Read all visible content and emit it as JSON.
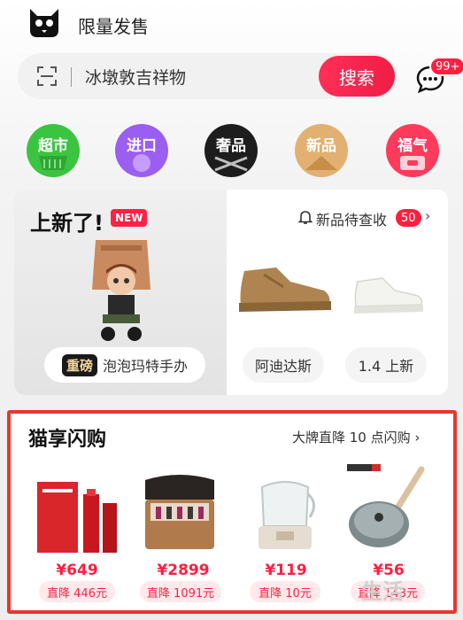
{
  "header": {
    "title": "限量发售"
  },
  "search": {
    "placeholder": "冰墩敦吉祥物",
    "button_label": "搜索",
    "message_badge": "99+"
  },
  "categories": [
    {
      "label": "超市",
      "color": "#3bc43f"
    },
    {
      "label": "进口",
      "color": "#9a5ff0"
    },
    {
      "label": "奢品",
      "color": "#1d1d1d"
    },
    {
      "label": "新品",
      "color": "#e2b071"
    },
    {
      "label": "福气",
      "color": "#ff3a5a"
    }
  ],
  "new_section": {
    "title": "上新了!",
    "badge": "NEW",
    "link_text": "新品待查收",
    "count": "50",
    "items": [
      {
        "tag": "重磅",
        "label": "泡泡玛特手办"
      },
      {
        "label": "阿迪达斯"
      },
      {
        "label": "1.4 上新"
      }
    ]
  },
  "flash_section": {
    "title": "猫享闪购",
    "subtitle": "大牌直降 10 点闪购",
    "products": [
      {
        "price": "¥649",
        "drop": "直降 446元"
      },
      {
        "price": "¥2899",
        "drop": "直降 1091元"
      },
      {
        "price": "¥119",
        "drop": "直降 10元"
      },
      {
        "price": "¥56",
        "drop": "直降 143元"
      }
    ]
  },
  "watermark": "生活"
}
